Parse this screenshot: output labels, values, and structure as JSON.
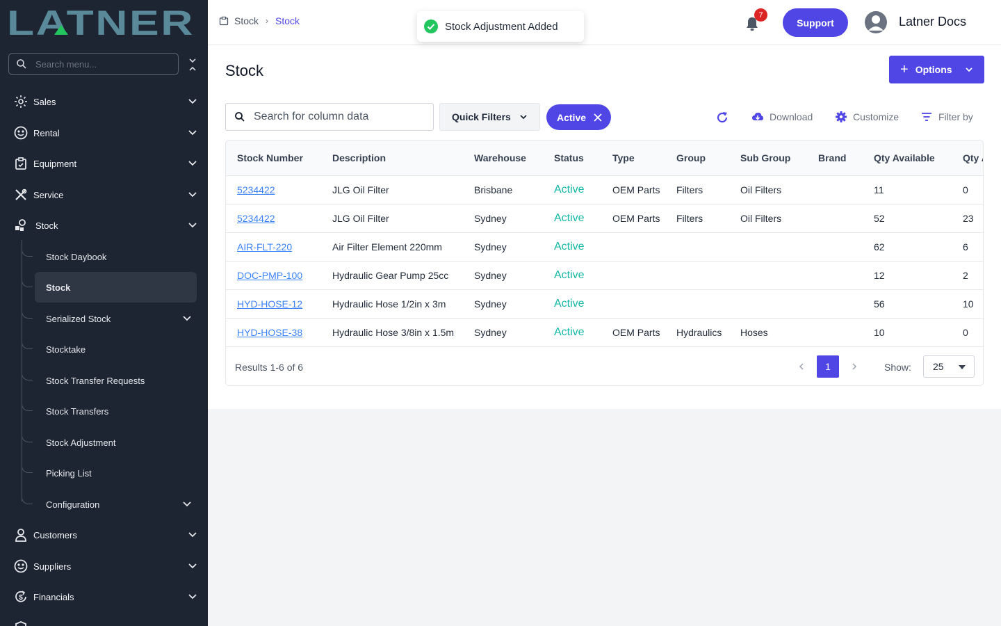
{
  "sidebar": {
    "logo_text": "LATNER",
    "search_placeholder": "Search menu...",
    "items": [
      {
        "label": "Sales",
        "icon": "sales-icon"
      },
      {
        "label": "Rental",
        "icon": "rental-icon"
      },
      {
        "label": "Equipment",
        "icon": "equipment-icon"
      },
      {
        "label": "Service",
        "icon": "service-icon"
      },
      {
        "label": "Stock",
        "icon": "stock-icon"
      },
      {
        "label": "Customers",
        "icon": "customers-icon"
      },
      {
        "label": "Suppliers",
        "icon": "suppliers-icon"
      },
      {
        "label": "Financials",
        "icon": "financials-icon"
      }
    ],
    "stock_subitems": [
      {
        "label": "Stock Daybook"
      },
      {
        "label": "Stock",
        "active": true
      },
      {
        "label": "Serialized Stock",
        "expandable": true
      },
      {
        "label": "Stocktake"
      },
      {
        "label": "Stock Transfer Requests"
      },
      {
        "label": "Stock Transfers"
      },
      {
        "label": "Stock Adjustment"
      },
      {
        "label": "Picking List"
      },
      {
        "label": "Configuration",
        "expandable": true
      }
    ]
  },
  "topbar": {
    "breadcrumb": [
      "Stock",
      "Stock"
    ],
    "notification_count": "7",
    "support_label": "Support",
    "user_name": "Latner Docs"
  },
  "toast": {
    "message": "Stock Adjustment Added"
  },
  "main": {
    "title": "Stock",
    "options_label": "Options",
    "search_placeholder": "Search for column data",
    "quick_filters_label": "Quick Filters",
    "active_filter_label": "Active",
    "download_label": "Download",
    "customize_label": "Customize",
    "filter_by_label": "Filter by"
  },
  "table": {
    "columns": [
      "Stock Number",
      "Description",
      "Warehouse",
      "Status",
      "Type",
      "Group",
      "Sub Group",
      "Brand",
      "Qty Available",
      "Qty A"
    ],
    "rows": [
      [
        "5234422",
        "JLG Oil Filter",
        "Brisbane",
        "Active",
        "OEM Parts",
        "Filters",
        "Oil Filters",
        "",
        "11",
        "0"
      ],
      [
        "5234422",
        "JLG Oil Filter",
        "Sydney",
        "Active",
        "OEM Parts",
        "Filters",
        "Oil Filters",
        "",
        "52",
        "23"
      ],
      [
        "AIR-FLT-220",
        "Air Filter Element 220mm",
        "Sydney",
        "Active",
        "",
        "",
        "",
        "",
        "62",
        "6"
      ],
      [
        "DOC-PMP-100",
        "Hydraulic Gear Pump 25cc",
        "Sydney",
        "Active",
        "",
        "",
        "",
        "",
        "12",
        "2"
      ],
      [
        "HYD-HOSE-12",
        "Hydraulic Hose 1/2in x 3m",
        "Sydney",
        "Active",
        "",
        "",
        "",
        "",
        "56",
        "10"
      ],
      [
        "HYD-HOSE-38",
        "Hydraulic Hose 3/8in x 1.5m",
        "Sydney",
        "Active",
        "OEM Parts",
        "Hydraulics",
        "Hoses",
        "",
        "10",
        "0"
      ]
    ],
    "results_text": "Results 1-6 of 6",
    "current_page": "1",
    "show_label": "Show:",
    "page_size": "25"
  },
  "colors": {
    "sidebar_bg": "#1e2532",
    "accent": "#4f46e5",
    "status_active": "#14b8a6",
    "link": "#3b82f6",
    "logo": "#5a8a9a"
  }
}
